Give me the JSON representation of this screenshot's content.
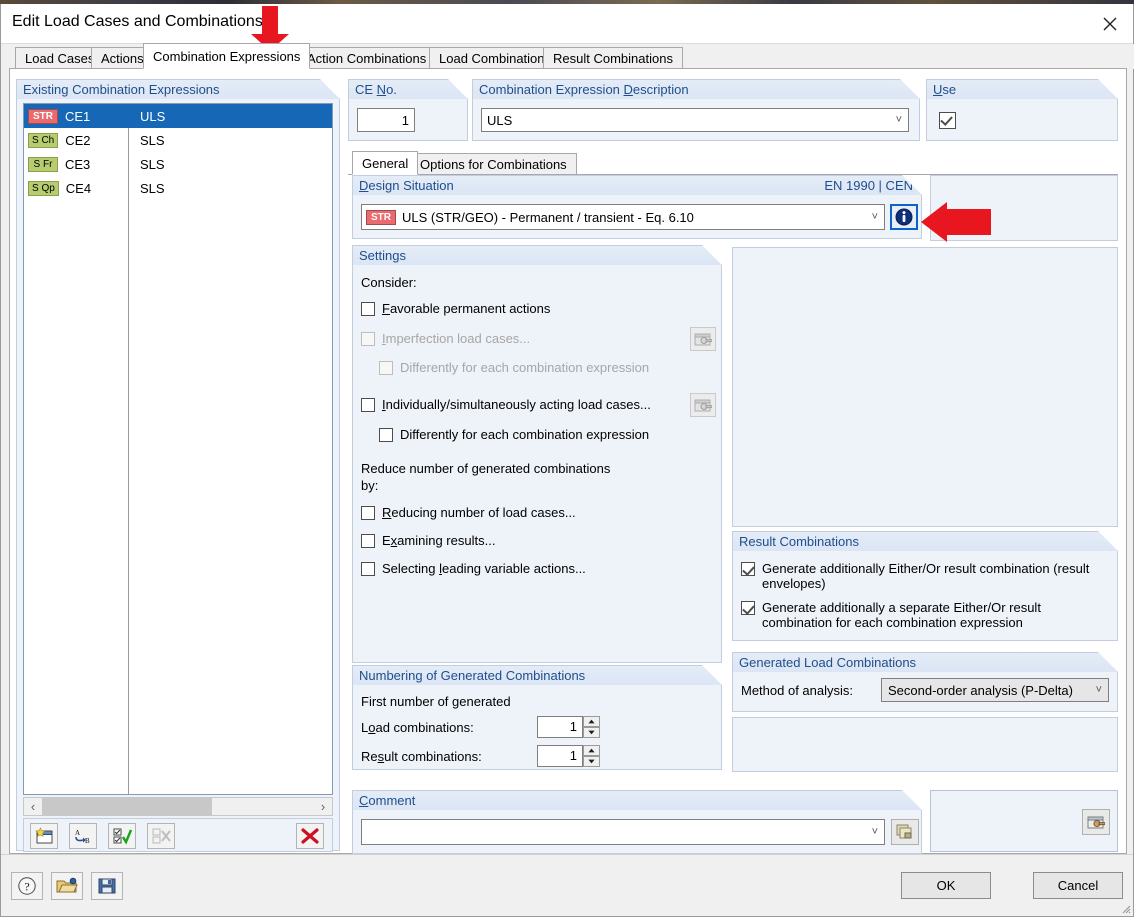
{
  "window": {
    "title": "Edit Load Cases and Combinations",
    "close_icon": "close-icon"
  },
  "tabs": [
    {
      "label": "Load Cases",
      "active": false
    },
    {
      "label": "Actions",
      "active": false
    },
    {
      "label": "Combination Expressions",
      "active": true
    },
    {
      "label": "Action Combinations",
      "active": false
    },
    {
      "label": "Load Combinations",
      "active": false
    },
    {
      "label": "Result Combinations",
      "active": false
    }
  ],
  "existing": {
    "title": "Existing Combination Expressions",
    "rows": [
      {
        "badge": "STR",
        "badge_type": "str",
        "name": "CE1",
        "desc": "ULS",
        "selected": true
      },
      {
        "badge": "S Ch",
        "badge_type": "sls",
        "name": "CE2",
        "desc": "SLS",
        "selected": false
      },
      {
        "badge": "S Fr",
        "badge_type": "sls",
        "name": "CE3",
        "desc": "SLS",
        "selected": false
      },
      {
        "badge": "S Qp",
        "badge_type": "sls",
        "name": "CE4",
        "desc": "SLS",
        "selected": false
      }
    ],
    "scroll_left_icon": "chevron-left-icon",
    "scroll_right_icon": "chevron-right-icon",
    "toolbar": [
      {
        "name": "new-combination-expression-button",
        "icon": "new-window-icon"
      },
      {
        "name": "rename-button",
        "icon": "rename-ab-icon"
      },
      {
        "name": "select-all-button",
        "icon": "checkbox-check-icon"
      },
      {
        "name": "deselect-all-button",
        "icon": "checkbox-clear-icon",
        "disabled": true
      },
      {
        "name": "delete-button",
        "icon": "red-x-icon"
      }
    ]
  },
  "ce_no": {
    "title": "CE No.",
    "value": "1"
  },
  "description": {
    "title": "Combination Expression Description",
    "value": "ULS",
    "caret_icon": "chevron-down-icon"
  },
  "use": {
    "title": "Use",
    "checked": true
  },
  "inner_tabs": [
    {
      "label": "General",
      "active": true
    },
    {
      "label": "Options for Combinations",
      "active": false
    }
  ],
  "design_situation": {
    "title": "Design Situation",
    "standard": "EN 1990 | CEN",
    "badge": "STR",
    "value": "ULS (STR/GEO) - Permanent / transient - Eq. 6.10",
    "caret_icon": "chevron-down-icon",
    "info_icon": "info-icon"
  },
  "settings": {
    "title": "Settings",
    "consider_label": "Consider:",
    "items": [
      {
        "label": "Favorable permanent actions",
        "mnemonic": "F",
        "checked": false,
        "disabled": false,
        "indent": 0,
        "has_icon": false
      },
      {
        "label": "Imperfection load cases...",
        "mnemonic": "I",
        "checked": false,
        "disabled": true,
        "indent": 0,
        "has_icon": true
      },
      {
        "label": "Differently for each combination expression",
        "mnemonic": "",
        "checked": false,
        "disabled": true,
        "indent": 1,
        "has_icon": false
      },
      {
        "label": "Individually/simultaneously acting load cases...",
        "mnemonic": "I",
        "checked": false,
        "disabled": false,
        "indent": 0,
        "has_icon": true
      },
      {
        "label": "Differently for each combination expression",
        "mnemonic": "",
        "checked": false,
        "disabled": false,
        "indent": 1,
        "has_icon": false
      }
    ],
    "reduce_label_line1": "Reduce number of generated combinations",
    "reduce_label_line2": "by:",
    "reduce_items": [
      {
        "label": "Reducing number of load cases...",
        "checked": false
      },
      {
        "label": "Examining results...",
        "checked": false
      },
      {
        "label": "Selecting leading variable actions...",
        "checked": false
      }
    ]
  },
  "numbering": {
    "title": "Numbering of Generated Combinations",
    "first_number_label": "First number of generated",
    "load_combinations_label": "Load combinations:",
    "load_combinations_value": "1",
    "result_combinations_label": "Result combinations:",
    "result_combinations_value": "1",
    "up_icon": "spinner-up-icon",
    "down_icon": "spinner-down-icon"
  },
  "result_combinations": {
    "title": "Result Combinations",
    "items": [
      {
        "label": "Generate additionally Either/Or result combination (result envelopes)",
        "checked": true
      },
      {
        "label": "Generate additionally a separate Either/Or result combination for each combination expression",
        "checked": true
      }
    ]
  },
  "generated_load_combinations": {
    "title": "Generated Load Combinations",
    "method_label": "Method of analysis:",
    "method_value": "Second-order analysis (P-Delta)",
    "caret_icon": "chevron-down-icon"
  },
  "comment": {
    "title": "Comment",
    "value": "",
    "caret_icon": "chevron-down-icon",
    "picker_icon": "copy-windows-icon"
  },
  "right_panel_picker_icon": "settings-window-icon",
  "footer": {
    "help_icon": "help-icon",
    "open_icon": "open-folder-icon",
    "save_icon": "save-disk-icon",
    "ok_label": "OK",
    "cancel_label": "Cancel"
  },
  "annotations": {
    "arrow_color": "#e8171f",
    "tab_arrow": "points to Combination Expressions tab",
    "info_arrow": "points to design situation info button"
  },
  "colors": {
    "selection": "#1667b5",
    "group_header_text": "#1f4e8c",
    "group_bg": "#eef2f9",
    "badge_str": "#e96a6f",
    "badge_sls": "#b6cc6e",
    "accent_border": "#0a64c8"
  }
}
